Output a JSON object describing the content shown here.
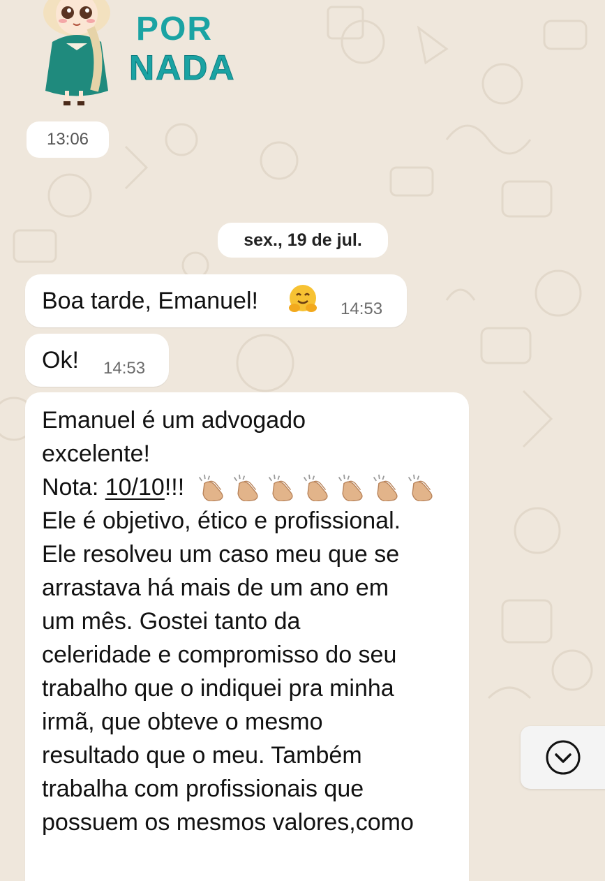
{
  "sticker": {
    "line1": "POR",
    "line2": "NADA"
  },
  "prev_message": {
    "time": "13:06"
  },
  "date_separator": "sex., 19 de jul.",
  "messages": [
    {
      "text": "Boa tarde, Emanuel!",
      "emoji": "hugging-face",
      "time": "14:53"
    },
    {
      "text": "Ok!",
      "time": "14:53"
    }
  ],
  "review": {
    "lines": [
      "Emanuel é um advogado",
      "excelente!",
      "Ele é objetivo, ético e  profissional.",
      "Ele resolveu um caso meu que se",
      "arrastava há mais de um ano em",
      "um mês. Gostei tanto da",
      "celeridade e compromisso do seu",
      "trabalho que o indiquei pra minha",
      "irmã, que obteve o mesmo",
      "resultado que o meu. Também",
      "trabalha com profissionais que",
      "possuem os mesmos valores,como"
    ],
    "rating_prefix": "Nota: ",
    "rating_value": "10/10",
    "rating_suffix": "!!! ",
    "clap_count": 7
  },
  "icons": {
    "scroll_down": "chevron-down-circle-icon",
    "clap": "clapping-hands-icon"
  },
  "colors": {
    "wallpaper": "#efe7dc",
    "bubble": "#ffffff",
    "sticker_text": "#1aa3a3"
  }
}
